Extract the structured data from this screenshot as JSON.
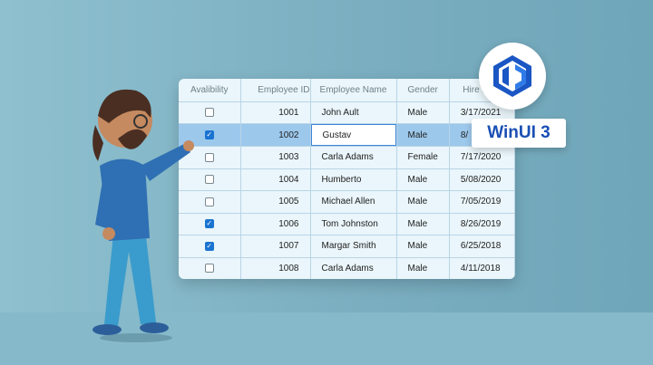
{
  "grid": {
    "columns": [
      "Avalibility",
      "Employee ID",
      "Employee Name",
      "Gender",
      "Hire Date"
    ],
    "rows": [
      {
        "available": false,
        "id": "1001",
        "name": "John Ault",
        "gender": "Male",
        "hire": "3/17/2021"
      },
      {
        "available": true,
        "id": "1002",
        "name": "Gustav",
        "gender": "Male",
        "hire": "8/",
        "selected": true,
        "editing": true
      },
      {
        "available": false,
        "id": "1003",
        "name": "Carla Adams",
        "gender": "Female",
        "hire": "7/17/2020"
      },
      {
        "available": false,
        "id": "1004",
        "name": "Humberto",
        "gender": "Male",
        "hire": "5/08/2020"
      },
      {
        "available": false,
        "id": "1005",
        "name": "Michael Allen",
        "gender": "Male",
        "hire": "7/05/2019"
      },
      {
        "available": true,
        "id": "1006",
        "name": "Tom Johnston",
        "gender": "Male",
        "hire": "8/26/2019"
      },
      {
        "available": true,
        "id": "1007",
        "name": "Margar Smith",
        "gender": "Male",
        "hire": "6/25/2018"
      },
      {
        "available": false,
        "id": "1008",
        "name": "Carla Adams",
        "gender": "Male",
        "hire": "4/11/2018"
      }
    ]
  },
  "badge": {
    "label": "WinUI 3"
  },
  "colors": {
    "accent": "#1a73d0",
    "selected_row": "#9cc8ec",
    "background": "#7db2c3"
  }
}
